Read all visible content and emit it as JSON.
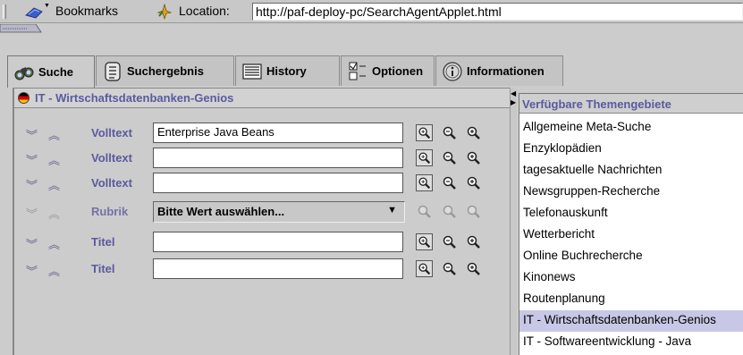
{
  "location_bar": {
    "bookmarks_label": "Bookmarks",
    "location_label": "Location:",
    "url": "http://paf-deploy-pc/SearchAgentApplet.html"
  },
  "tabs": [
    {
      "label": "Suche",
      "icon": "binoculars-icon",
      "active": true
    },
    {
      "label": "Suchergebnis",
      "icon": "document-list-icon",
      "active": false
    },
    {
      "label": "History",
      "icon": "history-list-icon",
      "active": false
    },
    {
      "label": "Optionen",
      "icon": "options-checklist-icon",
      "active": false
    },
    {
      "label": "Informationen",
      "icon": "info-icon",
      "active": false
    }
  ],
  "search_panel": {
    "title": "IT - Wirtschaftsdatenbanken-Genios",
    "rows": [
      {
        "field": "Volltext",
        "type": "text",
        "value": "Enterprise Java Beans",
        "disabled": false
      },
      {
        "field": "Volltext",
        "type": "text",
        "value": "",
        "disabled": false
      },
      {
        "field": "Volltext",
        "type": "text",
        "value": "",
        "disabled": false
      },
      {
        "field": "Rubrik",
        "type": "select",
        "value": "Bitte Wert auswählen...",
        "disabled": true
      },
      {
        "field": "Titel",
        "type": "text",
        "value": "",
        "disabled": false
      },
      {
        "field": "Titel",
        "type": "text",
        "value": "",
        "disabled": false
      }
    ]
  },
  "topics_panel": {
    "header": "Verfügbare Themengebiete",
    "items": [
      "Allgemeine Meta-Suche",
      "Enzyklopädien",
      "tagesaktuelle Nachrichten",
      "Newsgruppen-Recherche",
      "Telefonauskunft",
      "Wetterbericht",
      "Online Buchrecherche",
      "Kinonews",
      "Routenplanung",
      "IT - Wirtschaftsdatenbanken-Genios",
      "IT - Softwareentwicklung - Java"
    ],
    "selected_index": 9
  },
  "colors": {
    "label_blue": "#5a5aa0",
    "selection": "#c8c8e6",
    "background": "#cccccc"
  }
}
